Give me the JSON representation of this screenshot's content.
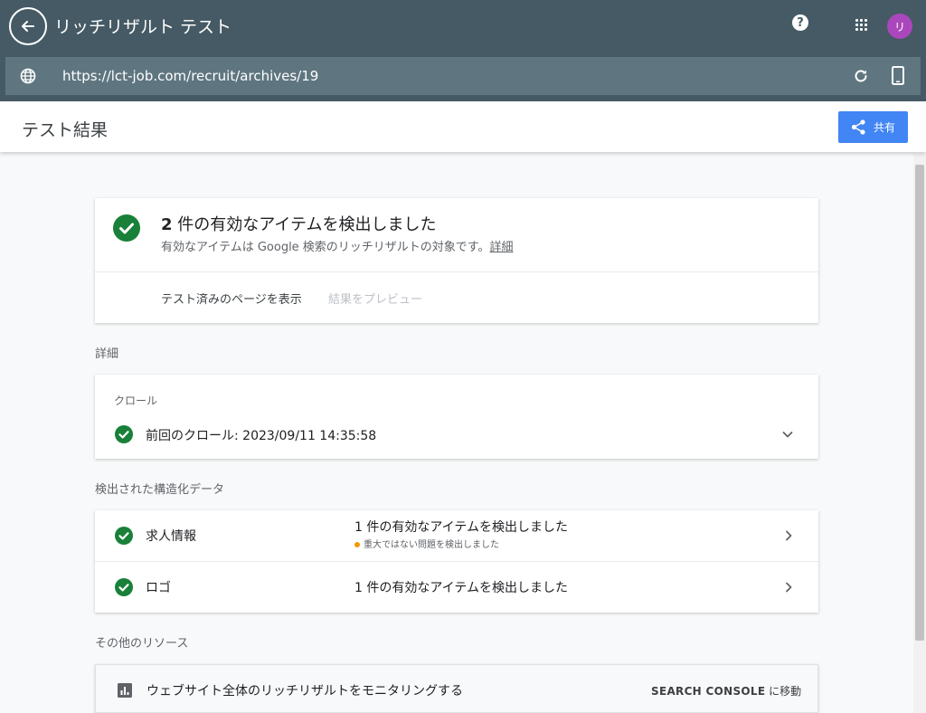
{
  "topbar": {
    "title": "リッチリザルト テスト",
    "help_glyph": "?",
    "avatar_initial": "リ",
    "url": "https://lct-job.com/recruit/archives/19"
  },
  "header": {
    "title": "テスト結果",
    "share_label": "共有"
  },
  "summary": {
    "count": "2",
    "heading_rest": " 件の有効なアイテムを検出しました",
    "subtext": "有効なアイテムは Google 検索のリッチリザルトの対象です。",
    "details_link": "詳細",
    "view_tested_page": "テスト済みのページを表示",
    "preview_results": "結果をプレビュー"
  },
  "sections": {
    "details": "詳細",
    "structured_data": "検出された構造化データ",
    "other_resources": "その他のリソース"
  },
  "crawl": {
    "label": "クロール",
    "last_crawl": "前回のクロール: 2023/09/11 14:35:58"
  },
  "structured_items": [
    {
      "name": "求人情報",
      "status": "1 件の有効なアイテムを検出しました",
      "warning": "重大ではない問題を検出しました"
    },
    {
      "name": "ロゴ",
      "status": "1 件の有効なアイテムを検出しました"
    }
  ],
  "resources": {
    "monitor_text": "ウェブサイト全体のリッチリザルトをモニタリングする",
    "console_label": "SEARCH CONSOLE",
    "console_suffix": " に移動"
  },
  "colors": {
    "topbar": "#455a64",
    "urlbar": "#5f7680",
    "accent": "#4285f4",
    "success": "#188038",
    "warning": "#f29900",
    "avatar": "#ab47bc"
  },
  "icons": [
    "back-arrow-icon",
    "help-icon",
    "apps-grid-icon",
    "globe-icon",
    "reload-icon",
    "mobile-device-icon",
    "share-icon",
    "check-circle-icon",
    "chevron-down-icon",
    "chevron-right-icon",
    "bar-chart-icon"
  ]
}
